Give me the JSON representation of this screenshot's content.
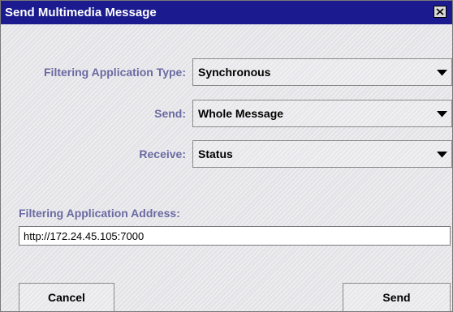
{
  "window": {
    "title": "Send Multimedia Message",
    "close_icon": "close-x-icon"
  },
  "form": {
    "filtering_type": {
      "label": "Filtering Application Type:",
      "value": "Synchronous"
    },
    "send": {
      "label": "Send:",
      "value": "Whole Message"
    },
    "receive": {
      "label": "Receive:",
      "value": "Status"
    },
    "address": {
      "label": "Filtering Application Address:",
      "value": "http://172.24.45.105:7000"
    }
  },
  "buttons": {
    "cancel_label": "Cancel",
    "send_label": "Send"
  },
  "colors": {
    "titlebar": "#1b1b8f",
    "label_text": "#6a6aa2",
    "background": "#e4e4e8"
  }
}
